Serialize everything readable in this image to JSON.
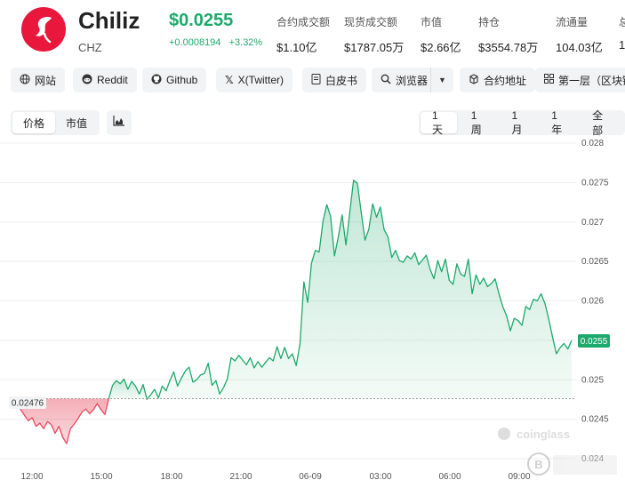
{
  "coin": {
    "name": "Chiliz",
    "symbol": "CHZ",
    "price": "$0.0255",
    "change_abs": "+0.0008194",
    "change_pct": "+3.32%",
    "logo_color": "#e8173b",
    "logo_icon": "chiliz-logo-icon"
  },
  "stats": [
    {
      "label": "合约成交额",
      "value": "$1.10亿"
    },
    {
      "label": "现货成交额",
      "value": "$1787.05万"
    },
    {
      "label": "市值",
      "value": "$2.66亿"
    },
    {
      "label": "持仓",
      "value": "$3554.78万"
    },
    {
      "label": "流通量",
      "value": "104.03亿"
    },
    {
      "label": "总",
      "value": "1"
    }
  ],
  "links": [
    {
      "label": "网站",
      "icon": "globe-icon"
    },
    {
      "label": "Reddit",
      "icon": "reddit-icon"
    },
    {
      "label": "Github",
      "icon": "github-icon"
    },
    {
      "label": "X(Twitter)",
      "icon": "x-icon"
    },
    {
      "label": "白皮书",
      "icon": "document-icon"
    },
    {
      "label": "浏览器",
      "icon": "explorer-icon"
    },
    {
      "label": "合约地址",
      "icon": "contract-icon"
    },
    {
      "label": "第一层（区块链",
      "icon": "grid-icon"
    }
  ],
  "view_toggle": {
    "options": [
      "价格",
      "市值"
    ],
    "selected": "价格"
  },
  "range_toggle": {
    "options": [
      "1天",
      "1周",
      "1月",
      "1年",
      "全部"
    ],
    "selected": "1天"
  },
  "chart_data": {
    "type": "area",
    "x_ticks": [
      "12:00",
      "15:00",
      "18:00",
      "21:00",
      "06-09",
      "03:00",
      "06:00",
      "09:00"
    ],
    "y_ticks": [
      "0.028",
      "0.0275",
      "0.027",
      "0.0265",
      "0.026",
      "0.0255",
      "0.025",
      "0.0245",
      "0.024"
    ],
    "ylim": [
      0.024,
      0.028
    ],
    "baseline_value": 0.02476,
    "baseline_label": "0.02476",
    "current_label": "0.0255",
    "up_color": "#1ea96c",
    "down_color": "#e84a5f",
    "watermark": "coinglass",
    "values": [
      0.02476,
      0.02462,
      0.02455,
      0.02448,
      0.02452,
      0.02441,
      0.02445,
      0.02438,
      0.02447,
      0.02443,
      0.02432,
      0.02441,
      0.02427,
      0.02419,
      0.02438,
      0.02444,
      0.02451,
      0.02459,
      0.02463,
      0.02457,
      0.02462,
      0.0247,
      0.02462,
      0.02456,
      0.02476,
      0.02493,
      0.02499,
      0.02495,
      0.02501,
      0.02488,
      0.02498,
      0.02492,
      0.02482,
      0.02494,
      0.02475,
      0.02481,
      0.02488,
      0.02477,
      0.02492,
      0.02486,
      0.02499,
      0.0251,
      0.02492,
      0.02502,
      0.02511,
      0.02516,
      0.02497,
      0.025,
      0.02506,
      0.02508,
      0.02521,
      0.02493,
      0.02499,
      0.02482,
      0.0249,
      0.02501,
      0.02528,
      0.02524,
      0.02531,
      0.02525,
      0.02519,
      0.02528,
      0.02515,
      0.02523,
      0.02516,
      0.02522,
      0.02528,
      0.02524,
      0.02542,
      0.02527,
      0.02541,
      0.02527,
      0.02533,
      0.02518,
      0.02546,
      0.02624,
      0.02598,
      0.02648,
      0.02664,
      0.02662,
      0.02701,
      0.02722,
      0.02707,
      0.02657,
      0.02681,
      0.02709,
      0.02671,
      0.02712,
      0.02753,
      0.02749,
      0.02712,
      0.02677,
      0.02691,
      0.02723,
      0.02706,
      0.02719,
      0.0269,
      0.02681,
      0.02655,
      0.02664,
      0.02651,
      0.02649,
      0.02657,
      0.02653,
      0.02661,
      0.02646,
      0.02652,
      0.02658,
      0.0264,
      0.02628,
      0.02651,
      0.02637,
      0.02653,
      0.02626,
      0.02621,
      0.02647,
      0.02634,
      0.02631,
      0.02653,
      0.02609,
      0.02633,
      0.02621,
      0.02629,
      0.02618,
      0.02622,
      0.02628,
      0.02609,
      0.02593,
      0.02581,
      0.02562,
      0.02578,
      0.02575,
      0.02569,
      0.02593,
      0.02589,
      0.02602,
      0.026,
      0.02609,
      0.02597,
      0.02577,
      0.02554,
      0.02533,
      0.02541,
      0.02546,
      0.02539,
      0.0255
    ]
  }
}
